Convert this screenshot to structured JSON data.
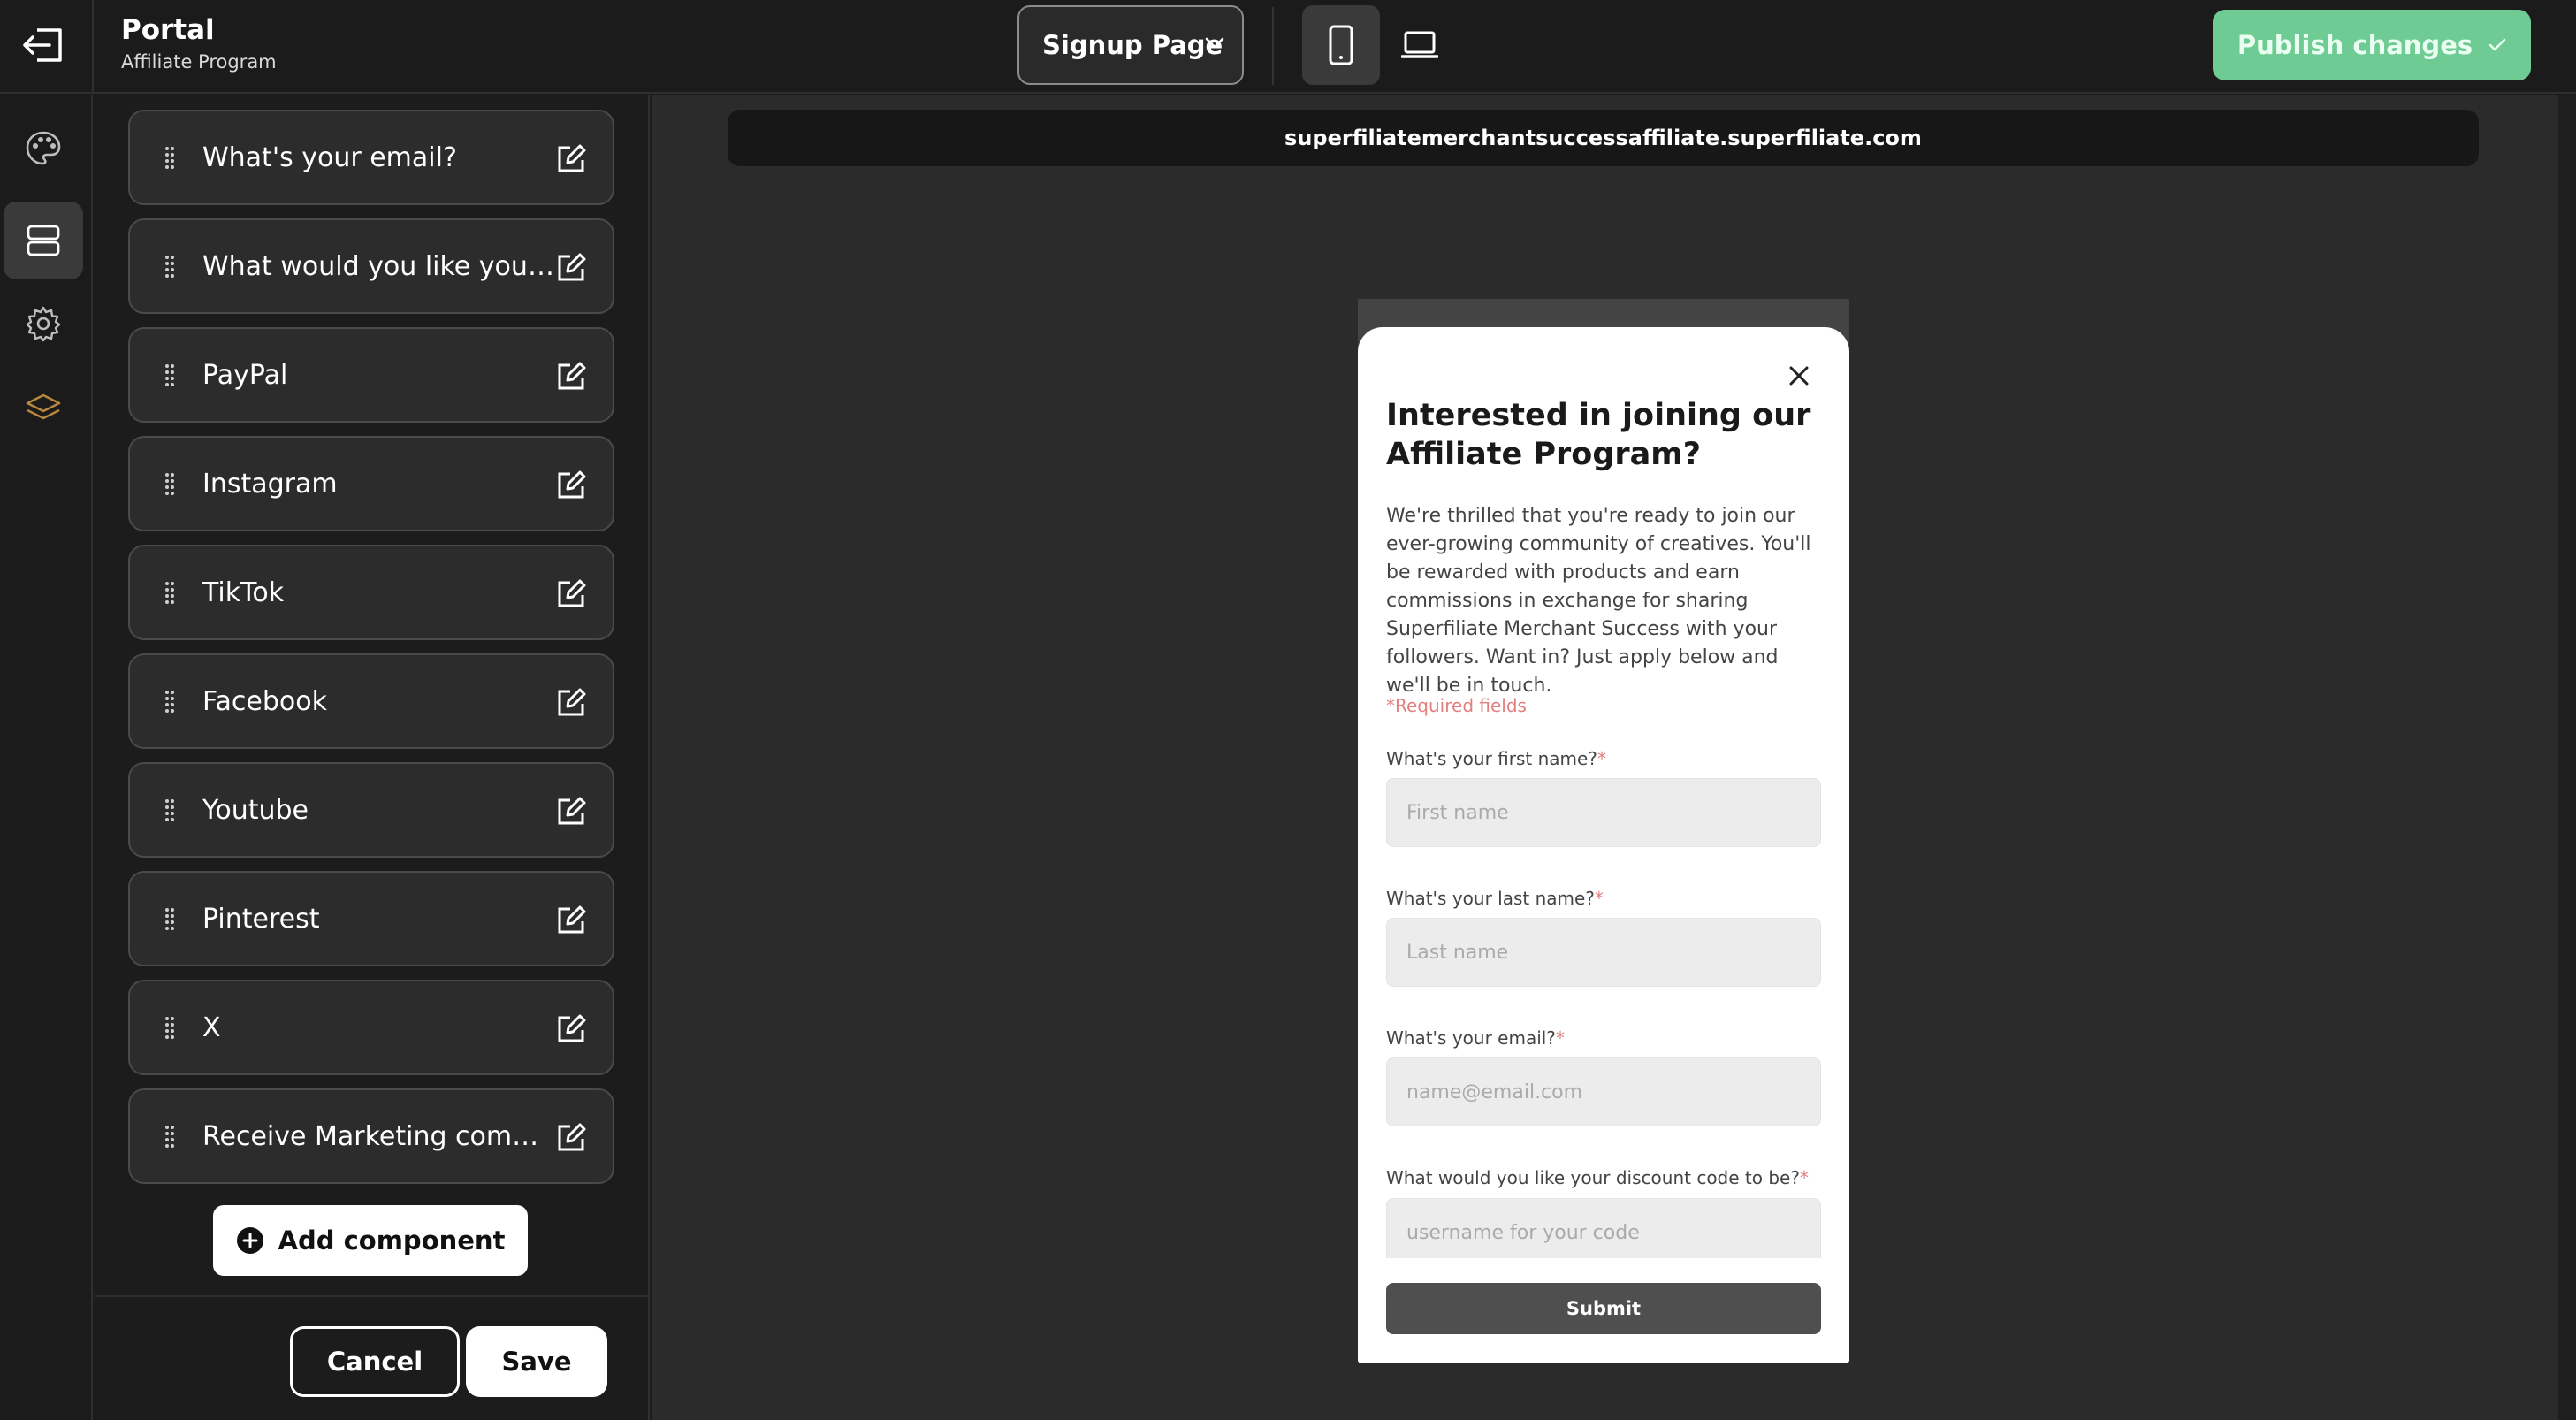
{
  "app": {
    "title": "Portal",
    "subtitle": "Affiliate Program"
  },
  "topbar": {
    "page_selector": "Signup Page",
    "device_modes": [
      "mobile",
      "desktop"
    ],
    "active_device": "mobile",
    "publish_label": "Publish changes"
  },
  "rail": {
    "items": [
      {
        "icon": "palette-icon",
        "active": false
      },
      {
        "icon": "layout-icon",
        "active": true
      },
      {
        "icon": "gear-icon",
        "active": false
      },
      {
        "icon": "layers-icon",
        "active": false
      }
    ]
  },
  "sidebar": {
    "components": [
      "What's your email?",
      "What would you like your discount code to be?",
      "PayPal",
      "Instagram",
      "TikTok",
      "Facebook",
      "Youtube",
      "Pinterest",
      "X",
      "Receive Marketing communications"
    ],
    "add_label": "Add component",
    "cancel_label": "Cancel",
    "save_label": "Save"
  },
  "preview": {
    "url": "superfiliatemerchantsuccessaffiliate.superfiliate.com",
    "form": {
      "title": "Interested in joining our Affiliate Program?",
      "description": "We're thrilled that you're ready to join our ever-growing community of creatives. You'll be rewarded with products and earn commissions in exchange for sharing Superfiliate Merchant Success with your followers. Want in? Just apply below and we'll be in touch.",
      "required_note": "*Required fields",
      "fields": [
        {
          "label": "What's your first name?",
          "placeholder": "First name"
        },
        {
          "label": "What's your last name?",
          "placeholder": "Last name"
        },
        {
          "label": "What's your email?",
          "placeholder": "name@email.com"
        },
        {
          "label": "What would you like your discount code to be?",
          "placeholder": "username for your code"
        }
      ],
      "submit_label": "Submit"
    }
  },
  "colors": {
    "accent": "#6fcb94",
    "required": "#e47f7f",
    "layers_icon": "#b8873f"
  }
}
